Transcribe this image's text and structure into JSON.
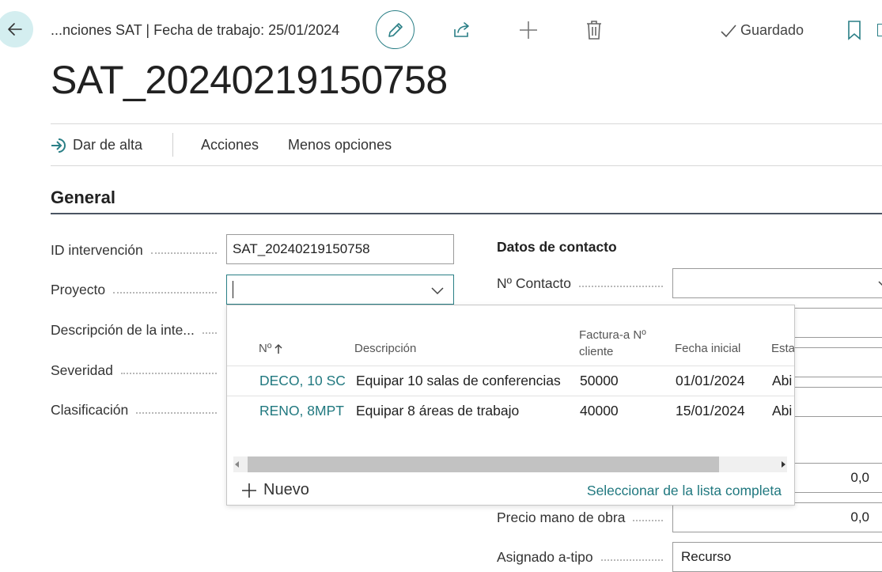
{
  "header": {
    "breadcrumb": "...nciones SAT | Fecha de trabajo: 25/01/2024",
    "saved_label": "Guardado",
    "icons": [
      "arrow-left-icon",
      "pencil-icon",
      "share-icon",
      "plus-icon",
      "trash-icon",
      "check-icon",
      "bookmark-icon"
    ]
  },
  "page": {
    "title": "SAT_20240219150758"
  },
  "actions": {
    "register": "Dar de alta",
    "actions": "Acciones",
    "fewer_options": "Menos opciones"
  },
  "general": {
    "title": "General",
    "fields": {
      "id_label": "ID intervención",
      "id_value": "SAT_20240219150758",
      "project_label": "Proyecto",
      "project_value": "",
      "description_label": "Descripción de la inte...",
      "severity_label": "Severidad",
      "classification_label": "Clasificación"
    }
  },
  "contact": {
    "title": "Datos de contacto",
    "contact_no_label": "Nº Contacto",
    "contact_no_value": "",
    "amount_value": "0,0",
    "labor_price_label": "Precio mano de obra",
    "labor_price_value": "0,0",
    "assigned_type_label": "Asignado a-tipo",
    "assigned_type_value": "Recurso"
  },
  "lookup": {
    "columns": {
      "no": "Nº",
      "description": "Descripción",
      "bill_to_line1": "Factura-a Nº",
      "bill_to_line2": "cliente",
      "start_date": "Fecha inicial",
      "status": "Esta"
    },
    "rows": [
      {
        "no": "DECO, 10 SC",
        "description": "Equipar 10 salas de conferencias",
        "customer": "50000",
        "start": "01/01/2024",
        "status": "Abi"
      },
      {
        "no": "RENO, 8MPT",
        "description": "Equipar 8 áreas de trabajo",
        "customer": "40000",
        "start": "15/01/2024",
        "status": "Abi"
      }
    ],
    "new_label": "Nuevo",
    "select_full_list": "Seleccionar de la lista completa"
  }
}
